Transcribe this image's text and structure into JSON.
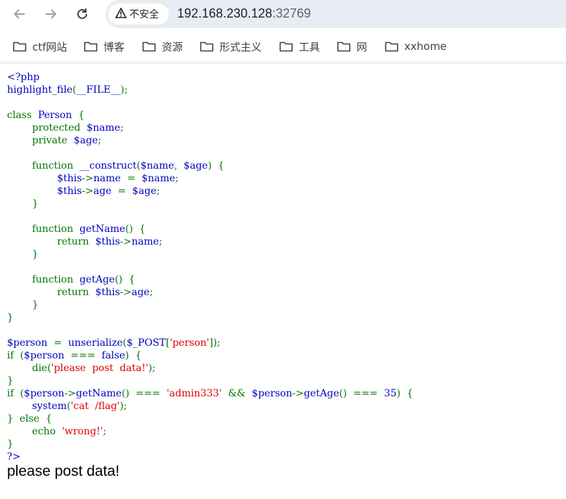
{
  "browser": {
    "security_label": "不安全",
    "url_host": "192.168.230.128",
    "url_port": ":32769",
    "icons": [
      "back-arrow-icon",
      "forward-arrow-icon",
      "reload-icon",
      "warning-icon"
    ]
  },
  "bookmarks": [
    {
      "label": "ctf网站"
    },
    {
      "label": "博客"
    },
    {
      "label": "资源"
    },
    {
      "label": "形式主义"
    },
    {
      "label": "工具"
    },
    {
      "label": "网"
    },
    {
      "label": "xxhome"
    }
  ],
  "code_lines": [
    [
      [
        "d",
        "&lt;?php"
      ]
    ],
    [
      [
        "d",
        "highlight_file"
      ],
      [
        "k",
        "("
      ],
      [
        "d",
        "__FILE__"
      ],
      [
        "k",
        ");"
      ]
    ],
    [],
    [
      [
        "k",
        "class  "
      ],
      [
        "d",
        "Person  "
      ],
      [
        "k",
        "{"
      ]
    ],
    [
      [
        "k",
        "        protected  "
      ],
      [
        "d",
        "$name"
      ],
      [
        "k",
        ";"
      ]
    ],
    [
      [
        "k",
        "        private  "
      ],
      [
        "d",
        "$age"
      ],
      [
        "k",
        ";"
      ]
    ],
    [],
    [
      [
        "k",
        "        function  "
      ],
      [
        "d",
        "__construct"
      ],
      [
        "k",
        "("
      ],
      [
        "d",
        "$name"
      ],
      [
        "k",
        ",  "
      ],
      [
        "d",
        "$age"
      ],
      [
        "k",
        ")  {"
      ]
    ],
    [
      [
        "k",
        "                "
      ],
      [
        "d",
        "$this"
      ],
      [
        "k",
        "-&gt;"
      ],
      [
        "d",
        "name  "
      ],
      [
        "k",
        "=  "
      ],
      [
        "d",
        "$name"
      ],
      [
        "k",
        ";"
      ]
    ],
    [
      [
        "k",
        "                "
      ],
      [
        "d",
        "$this"
      ],
      [
        "k",
        "-&gt;"
      ],
      [
        "d",
        "age  "
      ],
      [
        "k",
        "=  "
      ],
      [
        "d",
        "$age"
      ],
      [
        "k",
        ";"
      ]
    ],
    [
      [
        "k",
        "        }"
      ]
    ],
    [],
    [
      [
        "k",
        "        function  "
      ],
      [
        "d",
        "getName"
      ],
      [
        "k",
        "()  {"
      ]
    ],
    [
      [
        "k",
        "                return  "
      ],
      [
        "d",
        "$this"
      ],
      [
        "k",
        "-&gt;"
      ],
      [
        "d",
        "name"
      ],
      [
        "k",
        ";"
      ]
    ],
    [
      [
        "k",
        "        }"
      ]
    ],
    [],
    [
      [
        "k",
        "        function  "
      ],
      [
        "d",
        "getAge"
      ],
      [
        "k",
        "()  {"
      ]
    ],
    [
      [
        "k",
        "                return  "
      ],
      [
        "d",
        "$this"
      ],
      [
        "k",
        "-&gt;"
      ],
      [
        "d",
        "age"
      ],
      [
        "k",
        ";"
      ]
    ],
    [
      [
        "k",
        "        }"
      ]
    ],
    [
      [
        "k",
        "}"
      ]
    ],
    [],
    [
      [
        "d",
        "$person  "
      ],
      [
        "k",
        "=  "
      ],
      [
        "d",
        "unserialize"
      ],
      [
        "k",
        "("
      ],
      [
        "d",
        "$_POST"
      ],
      [
        "k",
        "["
      ],
      [
        "s",
        "'person'"
      ],
      [
        "k",
        "]);"
      ]
    ],
    [
      [
        "k",
        "if  ("
      ],
      [
        "d",
        "$person  "
      ],
      [
        "k",
        "===  "
      ],
      [
        "d",
        "false"
      ],
      [
        "k",
        ")  {"
      ]
    ],
    [
      [
        "k",
        "        die("
      ],
      [
        "s",
        "'please  post  data!'"
      ],
      [
        "k",
        ");"
      ]
    ],
    [
      [
        "k",
        "}"
      ]
    ],
    [
      [
        "k",
        "if  ("
      ],
      [
        "d",
        "$person"
      ],
      [
        "k",
        "-&gt;"
      ],
      [
        "d",
        "getName"
      ],
      [
        "k",
        "()  ===  "
      ],
      [
        "s",
        "'admin333'  "
      ],
      [
        "k",
        "&amp;&amp;  "
      ],
      [
        "d",
        "$person"
      ],
      [
        "k",
        "-&gt;"
      ],
      [
        "d",
        "getAge"
      ],
      [
        "k",
        "()  ===  "
      ],
      [
        "d",
        "35"
      ],
      [
        "k",
        ")  {"
      ]
    ],
    [
      [
        "k",
        "        "
      ],
      [
        "d",
        "system"
      ],
      [
        "k",
        "("
      ],
      [
        "s",
        "'cat  /flag'"
      ],
      [
        "k",
        ");"
      ]
    ],
    [
      [
        "k",
        "}  else  {"
      ]
    ],
    [
      [
        "k",
        "        echo  "
      ],
      [
        "s",
        "'wrong!'"
      ],
      [
        "k",
        ";"
      ]
    ],
    [
      [
        "k",
        "}"
      ]
    ],
    [
      [
        "d",
        "?&gt;"
      ]
    ]
  ],
  "output_message": "please post data!"
}
